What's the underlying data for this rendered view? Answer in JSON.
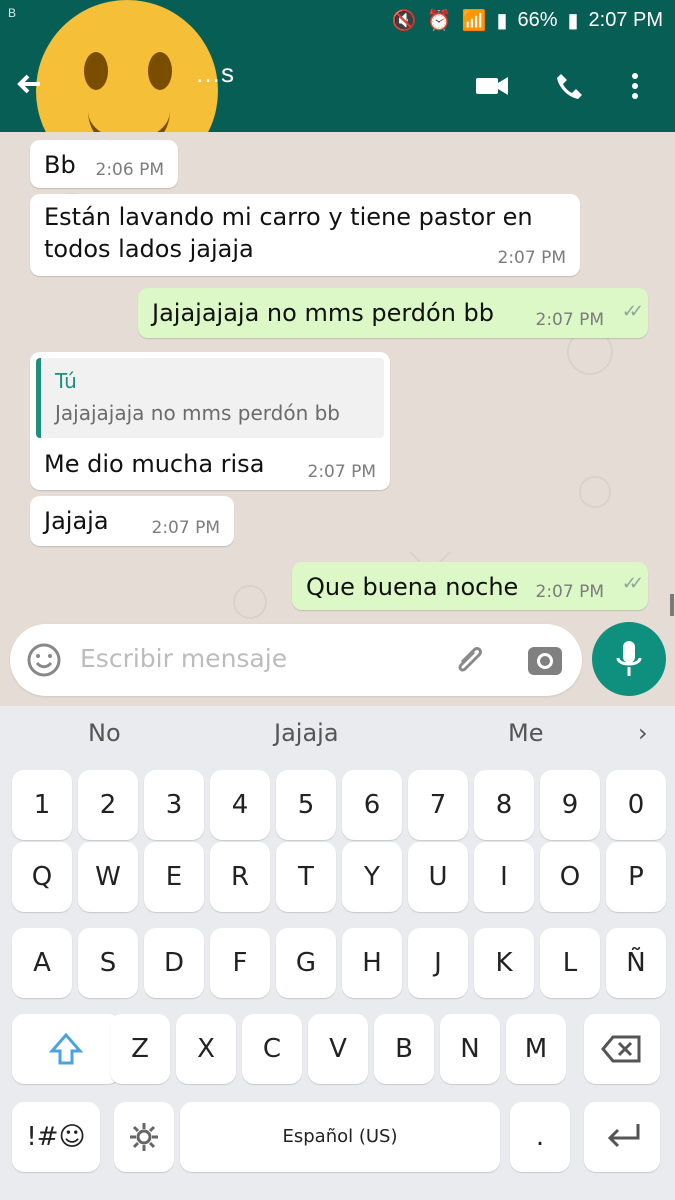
{
  "status_bar": {
    "battery": "66%",
    "time": "2:07 PM",
    "left_badge": "B"
  },
  "header": {
    "contact_name": "…s"
  },
  "messages": [
    {
      "text": "Bb",
      "time": "2:06 PM"
    },
    {
      "text_lines": [
        "Están lavando mi carro y tiene pastor en",
        "todos lados jajaja"
      ],
      "time": "2:07 PM"
    },
    {
      "text": "Jajajajaja no mms perdón bb",
      "time": "2:07 PM"
    },
    {
      "reply_author": "Tú",
      "reply_text": "Jajajajaja no mms perdón bb",
      "text": "Me dio mucha risa",
      "time": "2:07 PM"
    },
    {
      "text": "Jajaja",
      "time": "2:07 PM"
    },
    {
      "text": "Que buena noche",
      "time": "2:07 PM"
    }
  ],
  "input": {
    "placeholder": "Escribir mensaje"
  },
  "keyboard": {
    "suggestions": [
      "No",
      "Jajaja",
      "Me"
    ],
    "rows": [
      [
        "1",
        "2",
        "3",
        "4",
        "5",
        "6",
        "7",
        "8",
        "9",
        "0"
      ],
      [
        "Q",
        "W",
        "E",
        "R",
        "T",
        "Y",
        "U",
        "I",
        "O",
        "P"
      ],
      [
        "A",
        "S",
        "D",
        "F",
        "G",
        "H",
        "J",
        "K",
        "L",
        "Ñ"
      ],
      [
        "Z",
        "X",
        "C",
        "V",
        "B",
        "N",
        "M"
      ]
    ],
    "symbols_label": "!#☺",
    "space_label": "Español (US)",
    "period_label": "."
  }
}
